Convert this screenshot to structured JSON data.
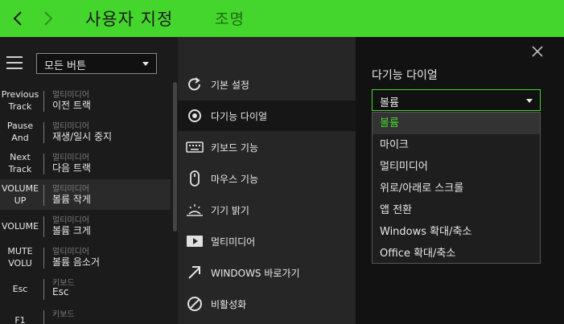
{
  "header": {
    "title": "사용자 지정",
    "subtitle": "조명",
    "accent_color": "#44d62c"
  },
  "left_panel": {
    "filter_select": {
      "value": "모든 버튼"
    },
    "bindings": [
      {
        "key": "Previous Track",
        "category": "멀티미디어",
        "action": "이전 트랙"
      },
      {
        "key": "Pause And",
        "category": "멀티미디어",
        "action": "재생/일시 중지"
      },
      {
        "key": "Next Track",
        "category": "멀티미디어",
        "action": "다음 트랙"
      },
      {
        "key": "VOLUME UP",
        "category": "멀티미디어",
        "action": "볼륨 작게"
      },
      {
        "key": "VOLUME",
        "category": "멀티미디어",
        "action": "볼륨 크게"
      },
      {
        "key": "MUTE VOLU",
        "category": "멀티미디어",
        "action": "볼륨 음소거"
      },
      {
        "key": "Esc",
        "category": "키보드",
        "action": "Esc"
      },
      {
        "key": "F1",
        "category": "키보드",
        "action": ""
      }
    ]
  },
  "middle_panel": {
    "items": [
      {
        "label": "기본 설정",
        "icon": "refresh-icon"
      },
      {
        "label": "다기능 다이얼",
        "icon": "dial-icon"
      },
      {
        "label": "키보드 기능",
        "icon": "keyboard-icon"
      },
      {
        "label": "마우스 기능",
        "icon": "mouse-icon"
      },
      {
        "label": "기기 밝기",
        "icon": "brightness-icon"
      },
      {
        "label": "멀티미디어",
        "icon": "play-icon"
      },
      {
        "label": "WINDOWS 바로가기",
        "icon": "arrow-icon"
      },
      {
        "label": "비활성화",
        "icon": "disable-icon"
      }
    ]
  },
  "right_panel": {
    "title": "다기능 다이얼",
    "dropdown": {
      "value": "볼륨",
      "options": [
        "볼륨",
        "마이크",
        "멀티미디어",
        "위로/아래로 스크롤",
        "앱 전환",
        "Windows 확대/축소",
        "Office 확대/축소"
      ]
    }
  }
}
